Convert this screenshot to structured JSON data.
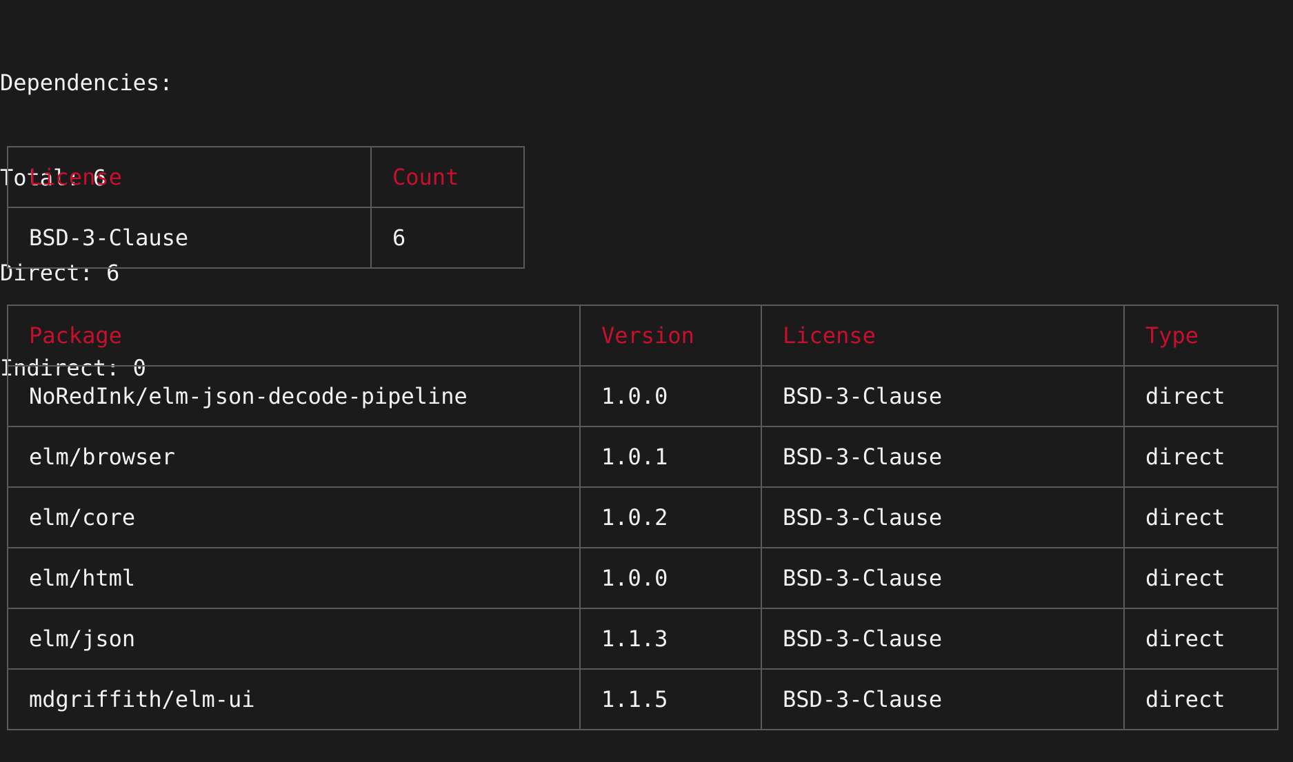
{
  "summary": {
    "heading": "Dependencies:",
    "total": "Total: 6",
    "direct": "Direct: 6",
    "indirect": "Indirect: 0"
  },
  "license_table": {
    "headers": [
      "License",
      "Count"
    ],
    "rows": [
      [
        "BSD-3-Clause",
        "6"
      ]
    ]
  },
  "deps_table": {
    "headers": [
      "Package",
      "Version",
      "License",
      "Type"
    ],
    "rows": [
      [
        "NoRedInk/elm-json-decode-pipeline",
        "1.0.0",
        "BSD-3-Clause",
        "direct"
      ],
      [
        "elm/browser",
        "1.0.1",
        "BSD-3-Clause",
        "direct"
      ],
      [
        "elm/core",
        "1.0.2",
        "BSD-3-Clause",
        "direct"
      ],
      [
        "elm/html",
        "1.0.0",
        "BSD-3-Clause",
        "direct"
      ],
      [
        "elm/json",
        "1.1.3",
        "BSD-3-Clause",
        "direct"
      ],
      [
        "mdgriffith/elm-ui",
        "1.1.5",
        "BSD-3-Clause",
        "direct"
      ]
    ]
  },
  "colors": {
    "background": "#1b1b1b",
    "text": "#f2f2f2",
    "header": "#c8102e",
    "border": "#5a5a5a"
  }
}
